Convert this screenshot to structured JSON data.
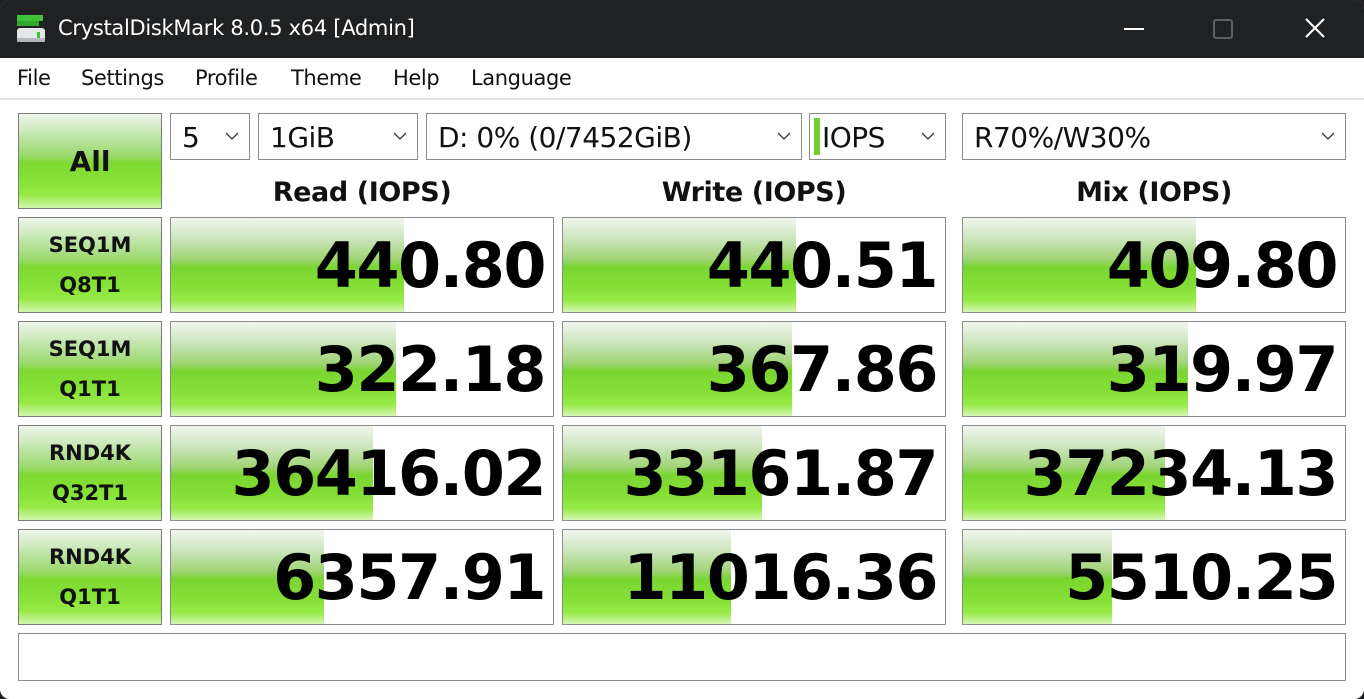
{
  "window": {
    "title": "CrystalDiskMark 8.0.5 x64 [Admin]",
    "app_icon": "disk-drive-icon",
    "controls": [
      "minimize",
      "maximize",
      "close"
    ]
  },
  "menu": {
    "items": [
      "File",
      "Settings",
      "Profile",
      "Theme",
      "Help",
      "Language"
    ]
  },
  "toolbar": {
    "all_label": "All",
    "test_count": "5",
    "test_size": "1GiB",
    "drive": "D: 0% (0/7452GiB)",
    "unit": "IOPS",
    "mix_ratio": "R70%/W30%",
    "accent_color": "#6fd130"
  },
  "columns": {
    "read": "Read (IOPS)",
    "write": "Write (IOPS)",
    "mix": "Mix (IOPS)"
  },
  "tests": [
    {
      "line1": "SEQ1M",
      "line2": "Q8T1",
      "read": {
        "value": "440.80",
        "level": 0.61
      },
      "write": {
        "value": "440.51",
        "level": 0.61
      },
      "mix": {
        "value": "409.80",
        "level": 0.61
      }
    },
    {
      "line1": "SEQ1M",
      "line2": "Q1T1",
      "read": {
        "value": "322.18",
        "level": 0.59
      },
      "write": {
        "value": "367.86",
        "level": 0.6
      },
      "mix": {
        "value": "319.97",
        "level": 0.59
      }
    },
    {
      "line1": "RND4K",
      "line2": "Q32T1",
      "read": {
        "value": "36416.02",
        "level": 0.53
      },
      "write": {
        "value": "33161.87",
        "level": 0.52
      },
      "mix": {
        "value": "37234.13",
        "level": 0.53
      }
    },
    {
      "line1": "RND4K",
      "line2": "Q1T1",
      "read": {
        "value": "6357.91",
        "level": 0.4
      },
      "write": {
        "value": "11016.36",
        "level": 0.44
      },
      "mix": {
        "value": "5510.25",
        "level": 0.39
      }
    }
  ],
  "comment": ""
}
